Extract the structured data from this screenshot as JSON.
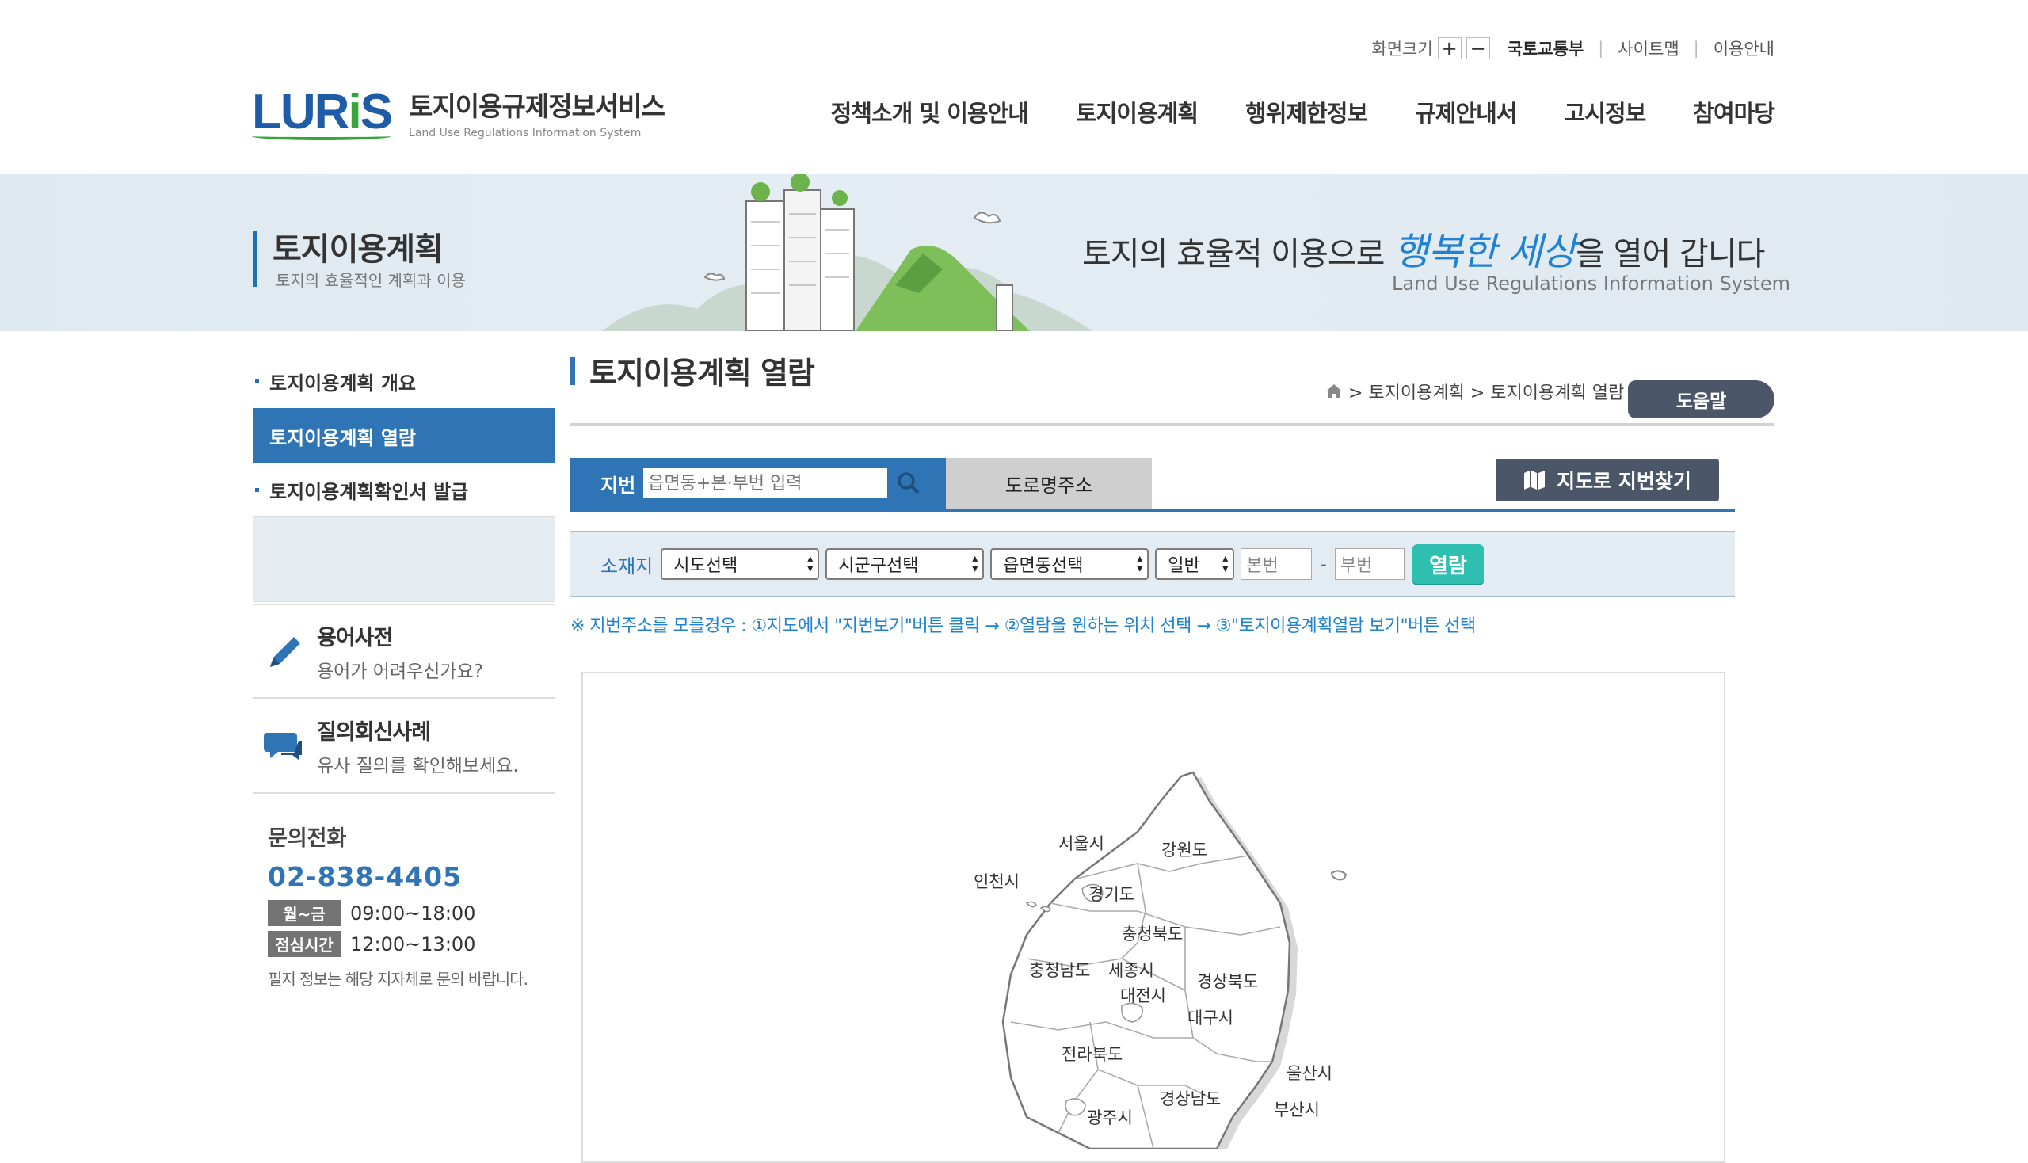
{
  "util": {
    "zoom_label": "화면크기",
    "zoom_in": "+",
    "zoom_out": "−",
    "links": [
      "국토교통부",
      "사이트맵",
      "이용안내"
    ]
  },
  "logo": {
    "mark": "LURIS",
    "title": "토지이용규제정보서비스",
    "subtitle": "Land Use Regulations Information System"
  },
  "gnb": [
    "정책소개 및 이용안내",
    "토지이용계획",
    "행위제한정보",
    "규제안내서",
    "고시정보",
    "참여마당"
  ],
  "banner": {
    "title": "토지이용계획",
    "subtitle": "토지의 효율적인 계획과 이용",
    "slogan_pre": "토지의 효율적 이용으로 ",
    "slogan_hl": "행복한 세상",
    "slogan_post": "을 열어 갑니다",
    "slogan_en": "Land Use Regulations Information System"
  },
  "lnb": {
    "items": [
      "토지이용계획 개요",
      "토지이용계획 열람",
      "토지이용계획확인서 발급"
    ]
  },
  "quick": [
    {
      "title": "용어사전",
      "sub": "용어가 어려우신가요?"
    },
    {
      "title": "질의회신사례",
      "sub": "유사 질의를 확인해보세요."
    }
  ],
  "contact": {
    "title": "문의전화",
    "phone": "02-838-4405",
    "hours": [
      {
        "badge": "월~금",
        "time": "09:00~18:00"
      },
      {
        "badge": "점심시간",
        "time": "12:00~13:00"
      }
    ],
    "note": "필지 정보는 해당 지자체로 문의 바랍니다."
  },
  "page": {
    "title": "토지이용계획 열람",
    "breadcrumb": "> 토지이용계획 > 토지이용계획 열람",
    "help": "도움말"
  },
  "search": {
    "tab_jibun": "지번",
    "jibun_placeholder": "읍면동+본·부번 입력",
    "tab_road": "도로명주소",
    "map_find": "지도로 지번찾기"
  },
  "filter": {
    "label": "소재지",
    "sido": "시도선택",
    "sigungu": "시군구선택",
    "eupmyeondong": "읍면동선택",
    "type": "일반",
    "bonbun": "본번",
    "bubun": "부번",
    "dash": "-",
    "view": "열람"
  },
  "hint": "※ 지번주소를 모를경우 : ①지도에서 \"지번보기\"버튼 클릭 → ②열람을 원하는 위치 선택 → ③\"토지이용계획열람 보기\"버튼 선택",
  "map": {
    "regions": [
      "서울시",
      "강원도",
      "인천시",
      "경기도",
      "충청북도",
      "충청남도",
      "세종시",
      "대전시",
      "경상북도",
      "대구시",
      "전라북도",
      "울산시",
      "경상남도",
      "부산시",
      "광주시"
    ]
  },
  "colors": {
    "primary": "#2f75b5",
    "dark_button": "#4b5668",
    "view_button": "#2fbfb0",
    "hint": "#1f82d2"
  }
}
